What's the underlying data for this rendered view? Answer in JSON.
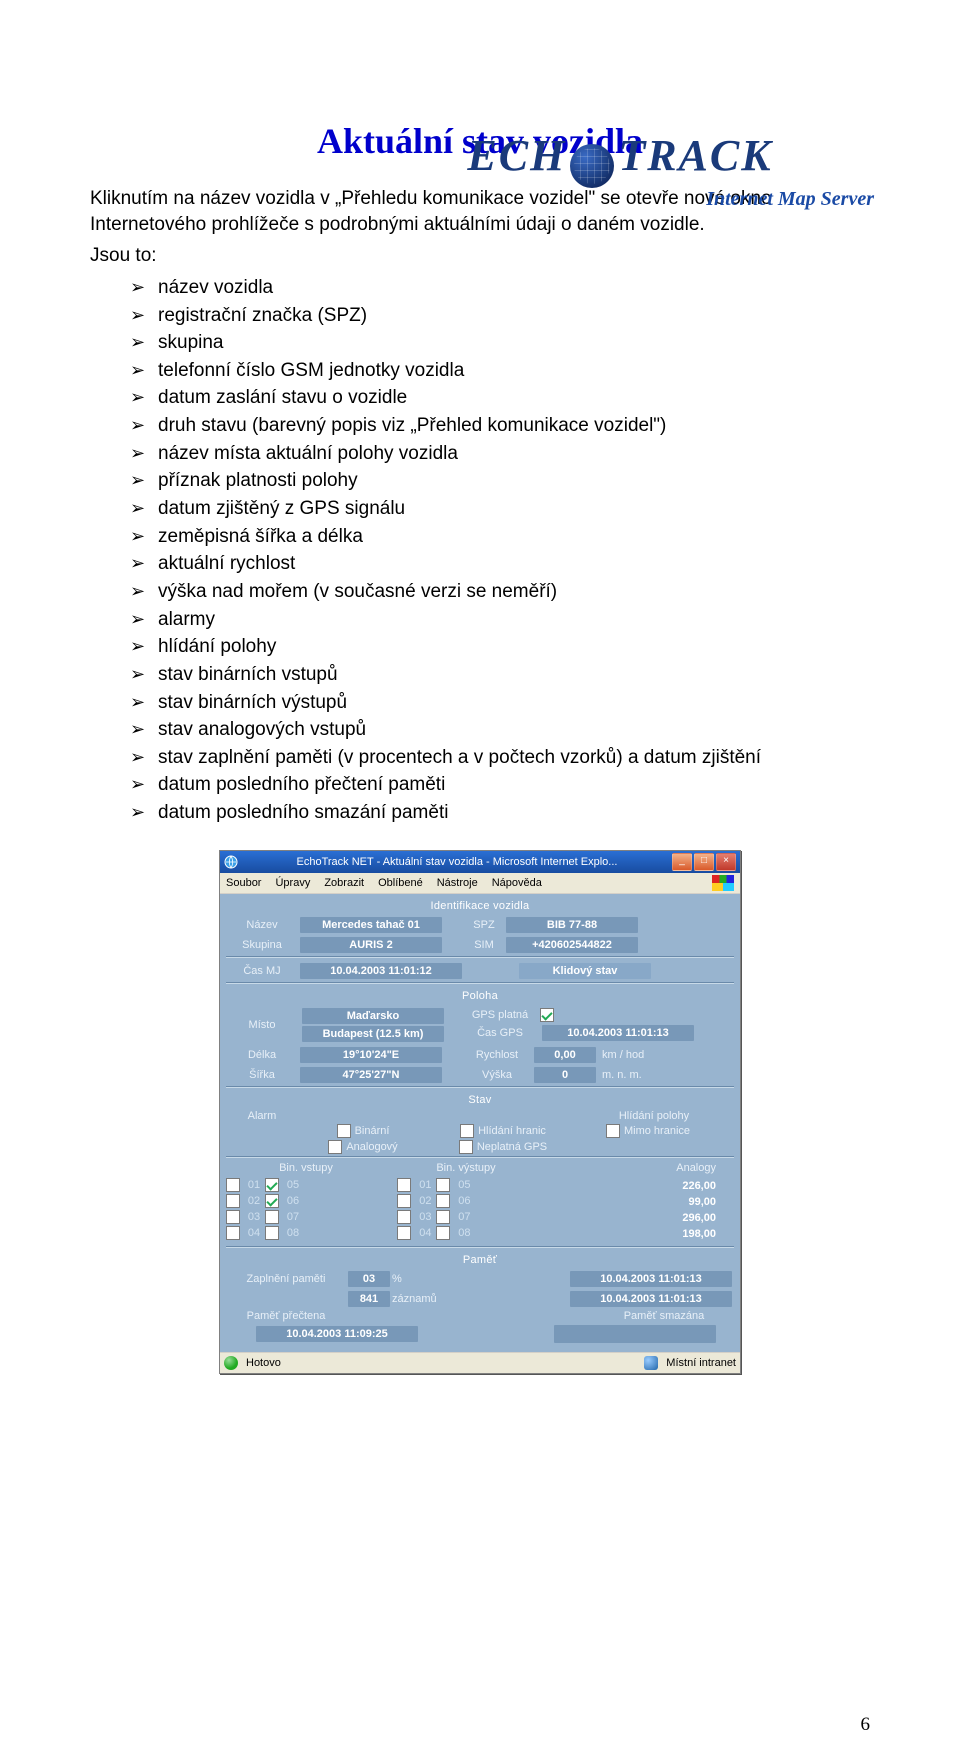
{
  "logo": {
    "main_left": "ECH",
    "main_right": "TRACK",
    "sub": "Internet Map Server"
  },
  "title": "Aktuální stav vozidla",
  "intro_p1": "Kliknutím na název vozidla v „Přehledu komunikace vozidel\" se otevře nové okno Internetového prohlížeče s podrobnými aktuálními údaji o daném vozidle.",
  "intro_p2": "Jsou to:",
  "bullets": [
    "název vozidla",
    "registrační značka (SPZ)",
    "skupina",
    "telefonní číslo GSM jednotky vozidla",
    "datum zaslání stavu o vozidle",
    "druh stavu (barevný popis viz „Přehled komunikace vozidel\")",
    "název místa aktuální polohy vozidla",
    "příznak platnosti polohy",
    "datum zjištěný z GPS signálu",
    "zeměpisná šířka a délka",
    "aktuální rychlost",
    "výška nad mořem (v současné verzi se neměří)",
    "alarmy",
    "hlídání polohy",
    "stav binárních vstupů",
    "stav binárních výstupů",
    "stav analogových vstupů",
    "stav zaplnění paměti (v procentech a v počtech vzorků) a datum zjištění",
    "datum posledního přečtení paměti",
    "datum posledního smazání paměti"
  ],
  "win": {
    "title": "EchoTrack NET - Aktuální stav vozidla - Microsoft Internet Explo...",
    "menu": [
      "Soubor",
      "Úpravy",
      "Zobrazit",
      "Oblíbené",
      "Nástroje",
      "Nápověda"
    ],
    "ident": {
      "head": "Identifikace vozidla",
      "nazev_lbl": "Název",
      "nazev_val": "Mercedes tahač 01",
      "spz_lbl": "SPZ",
      "spz_val": "BIB 77-88",
      "skup_lbl": "Skupina",
      "skup_val": "AURIS 2",
      "sim_lbl": "SIM",
      "sim_val": "+420602544822"
    },
    "casmj": {
      "lbl": "Čas MJ",
      "val": "10.04.2003 11:01:12",
      "state": "Klidový stav"
    },
    "poloha": {
      "head": "Poloha",
      "misto_lbl": "Místo",
      "misto_val1": "Maďarsko",
      "misto_val2": "Budapest (12.5 km)",
      "gps_platna_lbl": "GPS platná",
      "gps_platna_chk": true,
      "cas_gps_lbl": "Čas GPS",
      "cas_gps_val": "10.04.2003 11:01:13",
      "delka_lbl": "Délka",
      "delka_val": "19°10'24\"E",
      "rychl_lbl": "Rychlost",
      "rychl_val": "0,00",
      "rychl_unit": "km / hod",
      "sirka_lbl": "Šířka",
      "sirka_val": "47°25'27\"N",
      "vyska_lbl": "Výška",
      "vyska_val": "0",
      "vyska_unit": "m. n. m."
    },
    "stav": {
      "head": "Stav",
      "alarm_lbl": "Alarm",
      "hlid_lbl": "Hlídání polohy",
      "opts": [
        {
          "name": "Binární",
          "chk": false
        },
        {
          "name": "Hlídání hranic",
          "chk": false
        },
        {
          "name": "Mimo hranice",
          "chk": false
        },
        {
          "name": "Analogový",
          "chk": false
        },
        {
          "name": "Neplatná GPS",
          "chk": false
        }
      ]
    },
    "io": {
      "bin_in_lbl": "Bin. vstupy",
      "bin_out_lbl": "Bin. výstupy",
      "analog_lbl": "Analogy",
      "in": [
        {
          "n": "01",
          "c": false
        },
        {
          "n": "05",
          "c": true
        },
        {
          "n": "02",
          "c": false
        },
        {
          "n": "06",
          "c": true
        },
        {
          "n": "03",
          "c": false
        },
        {
          "n": "07",
          "c": false
        },
        {
          "n": "04",
          "c": false
        },
        {
          "n": "08",
          "c": false
        }
      ],
      "out": [
        {
          "n": "01",
          "c": false
        },
        {
          "n": "05",
          "c": false
        },
        {
          "n": "02",
          "c": false
        },
        {
          "n": "06",
          "c": false
        },
        {
          "n": "03",
          "c": false
        },
        {
          "n": "07",
          "c": false
        },
        {
          "n": "04",
          "c": false
        },
        {
          "n": "08",
          "c": false
        }
      ],
      "analog": [
        "226,00",
        "99,00",
        "296,00",
        "198,00"
      ]
    },
    "pamet": {
      "head": "Paměť",
      "zapl_lbl": "Zaplnění paměti",
      "zapl_val": "03",
      "zapl_pct": "%",
      "zapl_dt": "10.04.2003 11:01:13",
      "zaz_val": "841",
      "zaz_lbl": "záznamů",
      "zaz_dt": "10.04.2003 11:01:13",
      "prect_lbl": "Paměť přečtena",
      "prect_val": "10.04.2003 11:09:25",
      "smaz_lbl": "Paměť smazána",
      "smaz_val": ""
    },
    "status": {
      "left": "Hotovo",
      "right": "Místní intranet"
    }
  },
  "pageNum": "6"
}
